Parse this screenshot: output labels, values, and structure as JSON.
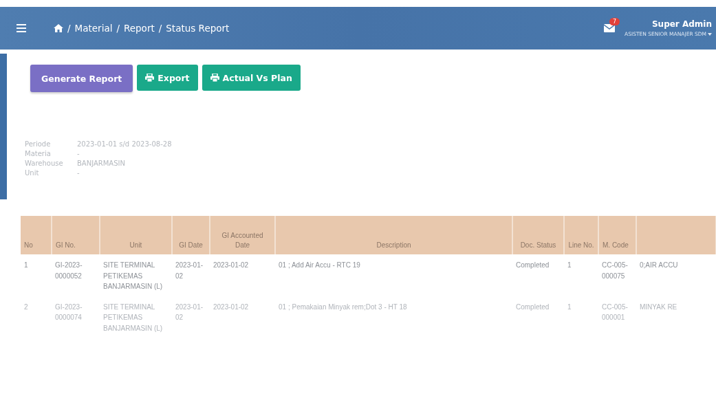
{
  "header": {
    "breadcrumb": [
      {
        "separator": "/",
        "label": "Material"
      },
      {
        "separator": "/",
        "label": "Report"
      },
      {
        "separator": "/",
        "label": "Status Report"
      }
    ],
    "notification_count": "7",
    "user_name": "Super Admin",
    "user_role": "ASISTEN SENIOR MANAJER SDM"
  },
  "buttons": [
    {
      "label": "Generate Report",
      "kind": "primary"
    },
    {
      "label": "Export",
      "kind": "print"
    },
    {
      "label": "Actual Vs Plan",
      "kind": "print"
    }
  ],
  "filters": [
    {
      "label": "Periode",
      "value": "2023-01-01 s/d 2023-08-28"
    },
    {
      "label": "Materia",
      "value": "-"
    },
    {
      "label": "Warehouse",
      "value": "BANJARMASIN"
    },
    {
      "label": "Unit",
      "value": "-"
    }
  ],
  "table": {
    "columns": [
      "No",
      "GI No.",
      "Unit",
      "GI Date",
      "GI Accounted Date",
      "Description",
      "Doc. Status",
      "Line No.",
      "M. Code",
      ""
    ],
    "rows": [
      {
        "cells": [
          "1",
          "GI-2023-0000052",
          "SITE TERMINAL PETIKEMAS BANJARMASIN (L)",
          "2023-01-02",
          "2023-01-02",
          "01 ; Add Air Accu - RTC 19",
          "Completed",
          "1",
          "CC-005-000075",
          "0;AIR ACCU"
        ]
      },
      {
        "cells": [
          "2",
          "GI-2023-0000074",
          "SITE TERMINAL PETIKEMAS BANJARMASIN (L)",
          "2023-01-02",
          "2023-01-02",
          "01 ; Pemakaian Minyak rem;Dot 3 - HT 18",
          "Completed",
          "1",
          "CC-005-000001",
          "MINYAK RE"
        ]
      }
    ]
  }
}
